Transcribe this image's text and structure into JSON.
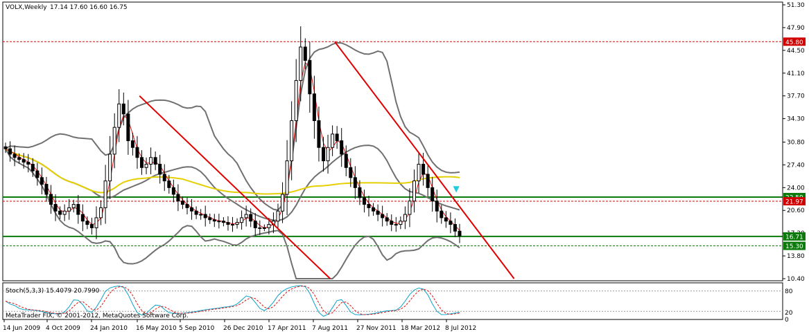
{
  "chart_header": {
    "symbol_label": "VOLX,Weekly",
    "ohlc_label": "17.14 17.60 16.60 16.75"
  },
  "stochastic": {
    "label": "Stoch(5,3,3) 15.4079 20.7990",
    "levels": [
      "80",
      "20",
      "0"
    ],
    "main_color": "#0aa3c8",
    "signal_color": "#e01010"
  },
  "copyright": "MetaTrader FIX, © 2001-2012, MetaQuotes Software Corp.",
  "price_axis": {
    "ticks": [
      "51.30",
      "47.90",
      "44.50",
      "41.10",
      "37.70",
      "34.30",
      "30.80",
      "27.40",
      "24.00",
      "20.60",
      "17.20",
      "13.80",
      "10.40"
    ],
    "ylim": [
      10.4,
      51.3
    ]
  },
  "date_axis": {
    "ticks": [
      "14 Jun 2009",
      "4 Oct 2009",
      "24 Jan 2010",
      "16 May 2010",
      "5 Sep 2010",
      "26 Dec 2010",
      "17 Apr 2011",
      "7 Aug 2011",
      "27 Nov 2011",
      "18 Mar 2012",
      "8 Jul 2012"
    ]
  },
  "price_tags": [
    {
      "name": "resistance-45-tag",
      "text": "45.80",
      "value": 45.8,
      "color": "#d00000"
    },
    {
      "name": "upper-green-tag",
      "text": "22.59",
      "value": 22.59,
      "color": "#0a7a0a"
    },
    {
      "name": "red-level-tag",
      "text": "21.97",
      "value": 21.97,
      "color": "#d00000"
    },
    {
      "name": "current-price-tag",
      "text": "16.71",
      "value": 16.71,
      "color": "#0a7a0a"
    },
    {
      "name": "support-15-tag",
      "text": "15.30",
      "value": 15.3,
      "color": "#0a7a0a"
    }
  ],
  "colors": {
    "candles": "#000000",
    "bollinger": "#707070",
    "ma_long": "#e6cf00",
    "ma_short": "#e01010",
    "trendline": "#e00000",
    "green_level": "#0a7a0a",
    "marker": "#22ccdd"
  },
  "chart_data": {
    "type": "candlestick",
    "series": [
      {
        "name": "VOLX,Weekly",
        "close_approx": [
          29.8,
          29.0,
          28.5,
          28.2,
          27.8,
          27.5,
          26.5,
          25.5,
          24.5,
          23.0,
          21.5,
          20.5,
          20.0,
          20.5,
          21.0,
          21.5,
          20.0,
          19.0,
          18.5,
          18.0,
          19.5,
          21.0,
          25.0,
          29.0,
          33.0,
          36.5,
          35.0,
          31.0,
          30.0,
          28.5,
          27.0,
          27.5,
          28.5,
          27.5,
          26.0,
          25.0,
          24.0,
          23.0,
          22.0,
          21.5,
          21.0,
          20.5,
          20.0,
          20.0,
          19.5,
          19.2,
          19.0,
          19.0,
          18.8,
          18.5,
          18.5,
          18.8,
          19.5,
          20.0,
          19.0,
          18.0,
          18.0,
          18.0,
          18.5,
          19.0,
          20.5,
          23.0,
          28.0,
          34.0,
          40.0,
          45.0,
          43.0,
          38.0,
          34.0,
          30.0,
          28.0,
          30.0,
          32.0,
          31.0,
          29.0,
          27.0,
          25.5,
          24.0,
          22.5,
          21.5,
          21.0,
          20.5,
          20.0,
          19.5,
          19.0,
          18.5,
          18.5,
          19.0,
          20.0,
          22.0,
          25.0,
          27.5,
          26.0,
          24.0,
          22.0,
          20.5,
          19.5,
          19.0,
          18.5,
          17.5,
          16.8
        ]
      },
      {
        "name": "45.80 level",
        "value": 45.8
      },
      {
        "name": "22.59 level",
        "value": 22.59
      },
      {
        "name": "21.97 level",
        "value": 21.97
      },
      {
        "name": "16.71 level",
        "value": 16.71
      },
      {
        "name": "15.30 level",
        "value": 15.3
      }
    ],
    "ylim": [
      10.4,
      51.3
    ],
    "stochastic_levels": [
      0,
      20,
      80
    ],
    "grid": false
  }
}
